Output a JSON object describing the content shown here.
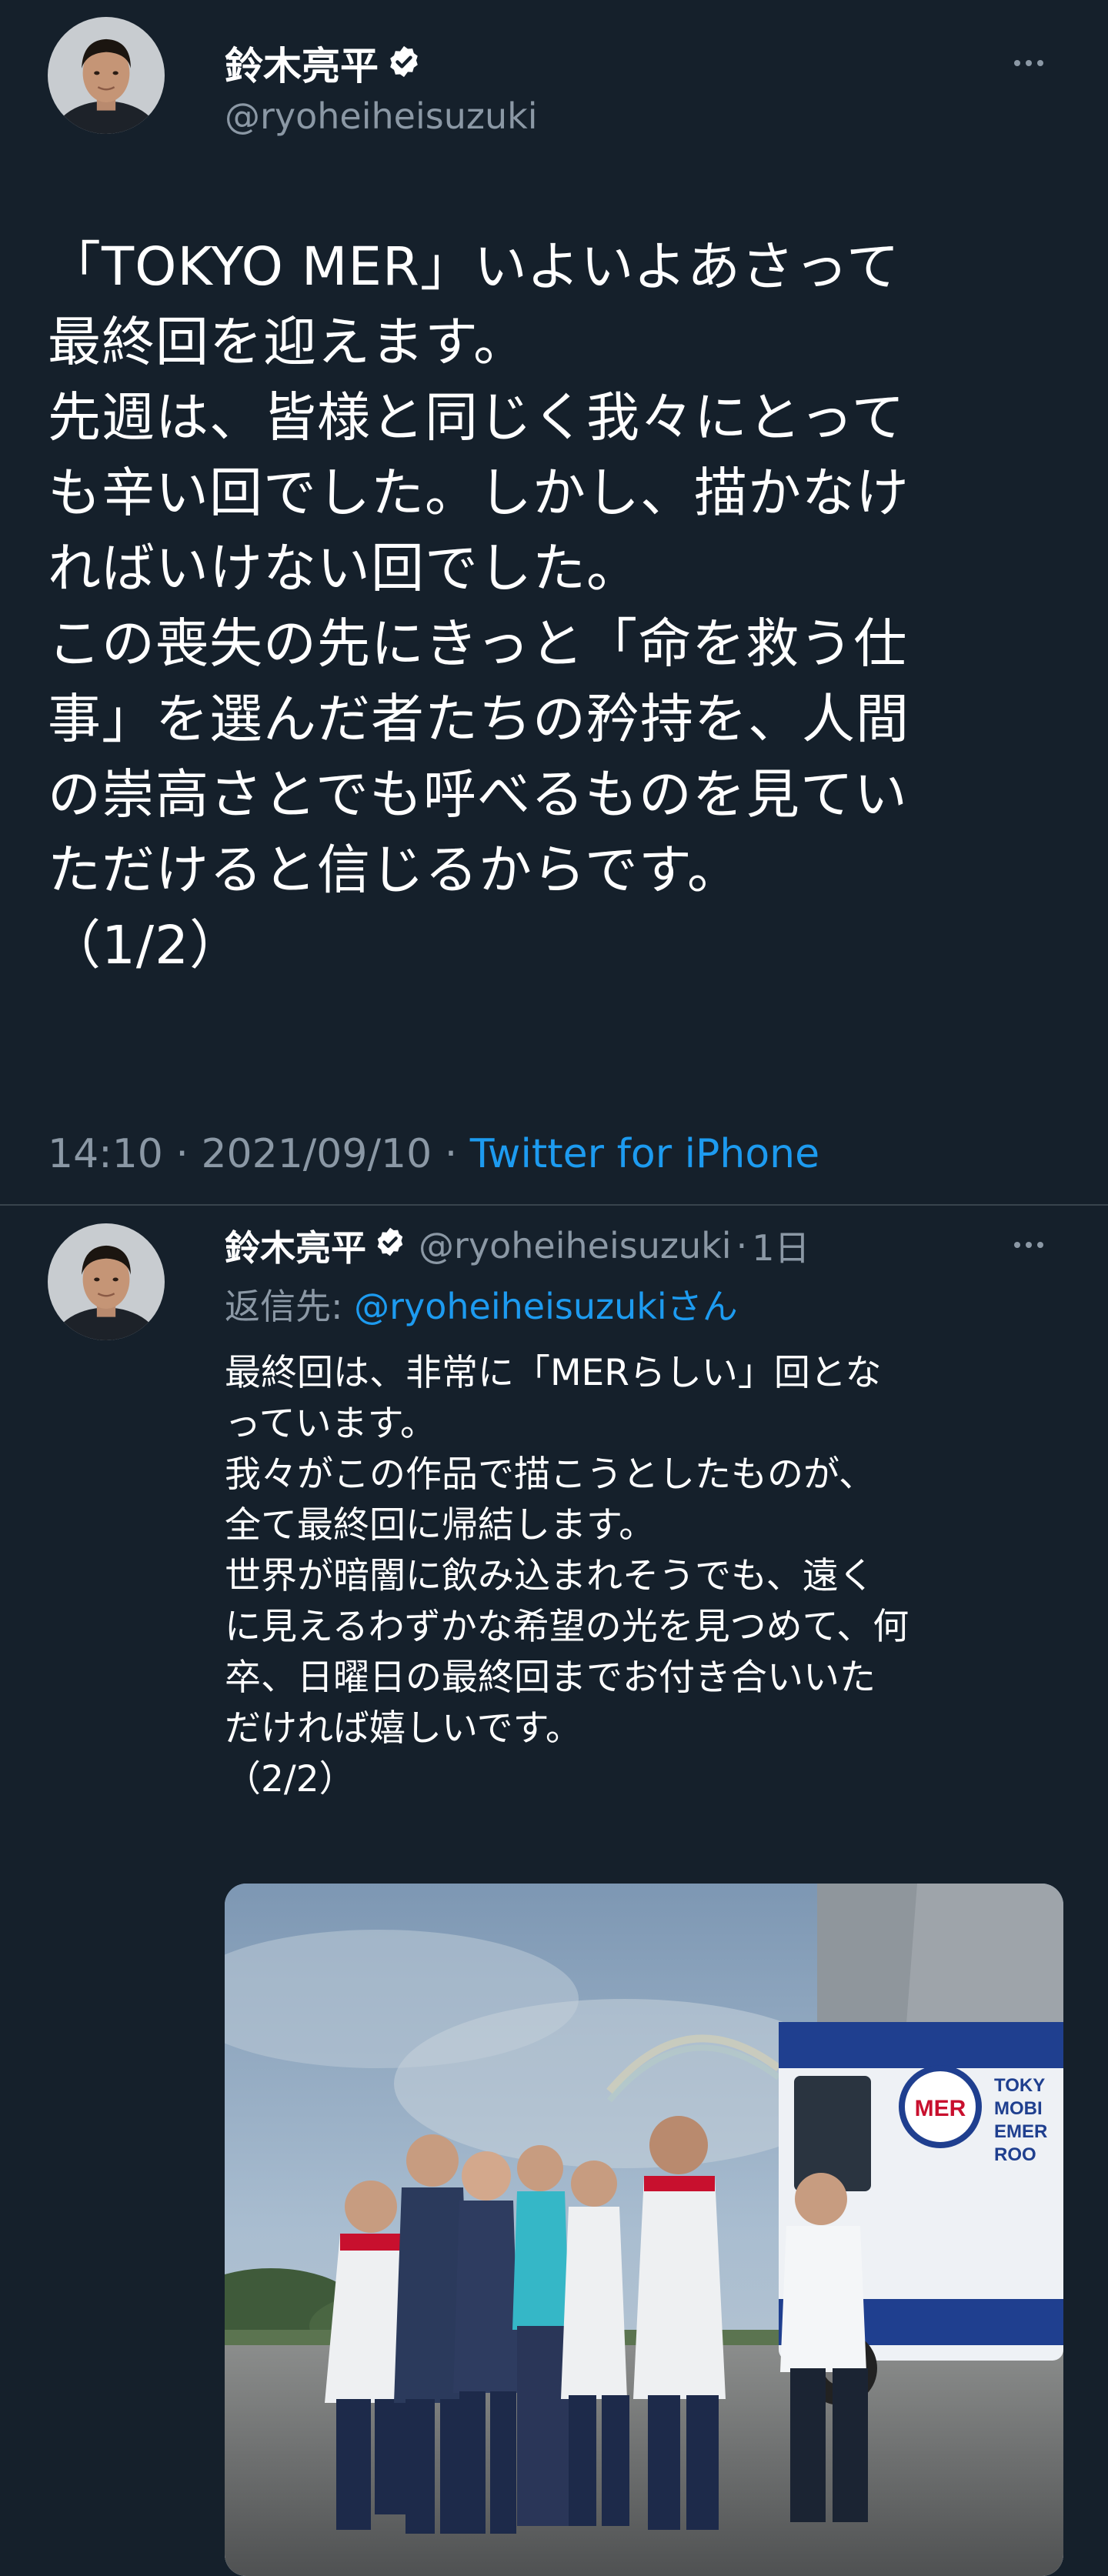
{
  "main_tweet": {
    "display_name": "鈴木亮平",
    "handle": "@ryoheiheisuzuki",
    "text": "「TOKYO MER」いよいよあさって\n最終回を迎えます。\n先週は、皆様と同じく我々にとって\nも辛い回でした。しかし、描かなけ\nればいけない回でした。\nこの喪失の先にきっと「命を救う仕\n事」を選んだ者たちの矜持を、人間\nの崇高さとでも呼べるものを見てい\nただけると信じるからです。\n（1/2）",
    "time": "14:10",
    "date": "2021/09/10",
    "separator": "·",
    "source": "Twitter for iPhone"
  },
  "reply_tweet": {
    "display_name": "鈴木亮平",
    "handle": "@ryoheiheisuzuki",
    "age": "1日",
    "reply_prefix": "返信先: ",
    "reply_mention": "@ryoheiheisuzukiさん",
    "text": "最終回は、非常に「MERらしい」回とな\nっています。\n我々がこの作品で描こうとしたものが、\n全て最終回に帰結します。\n世界が暗闇に飲み込まれそうでも、遠く\nに見えるわずかな希望の光を見つめて、何\n卒、日曜日の最終回までお付き合いいた\nだければ嬉しいです。\n（2/2）",
    "photo_truck_text": [
      "TOKY",
      "MOBI",
      "EMER",
      "ROO"
    ],
    "photo_logo_text": "MER"
  },
  "icons": {
    "verified": "verified-badge-icon",
    "more": "more-options-icon"
  },
  "colors": {
    "background": "#15202b",
    "text": "#ffffff",
    "secondary": "#8b98a5",
    "link": "#1d9bf0",
    "divider": "#38444d"
  }
}
